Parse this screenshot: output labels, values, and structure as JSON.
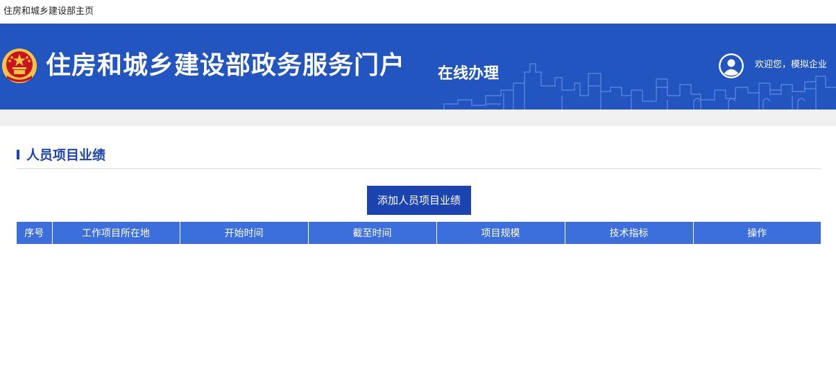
{
  "topbar": {
    "home_link": "住房和城乡建设部主页"
  },
  "header": {
    "title": "住房和城乡建设部政务服务门户",
    "subtitle": "在线办理",
    "welcome": "欢迎您，模拟企业",
    "emblem_icon": "national-emblem-icon",
    "user_icon": "user-avatar-icon"
  },
  "section": {
    "title": "人员项目业绩"
  },
  "actions": {
    "add_label": "添加人员项目业绩"
  },
  "table": {
    "columns": [
      "序号",
      "工作项目所在地",
      "开始时间",
      "截至时间",
      "项目规模",
      "技术指标",
      "操作"
    ],
    "rows": []
  },
  "colors": {
    "banner": "#2255c0",
    "primary": "#1c44b0",
    "table_header": "#3d6fdc",
    "emblem_red": "#c8141e",
    "emblem_gold": "#f6c445"
  }
}
